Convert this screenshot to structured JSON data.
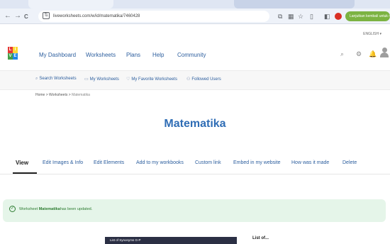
{
  "browser": {
    "back_icon": "←",
    "forward_icon": "→",
    "reload_icon": "C",
    "site_info_icon": "⇅",
    "url": "liveworksheets.com/w/id/matematika/7460428",
    "icons": [
      "translate-icon",
      "extension-icon",
      "star-icon",
      "puzzle-icon",
      "sidebar-icon",
      "profile-icon"
    ],
    "resume_label": "Lanjutkan kembali untuk mengupdate",
    "menu_icon": "⋮"
  },
  "site": {
    "language": "ENGLISH",
    "logo_letters": [
      "L",
      "I",
      "V",
      "E"
    ],
    "logo_colors": [
      "#e53935",
      "#fdd835",
      "#43a047",
      "#1e88e5"
    ],
    "nav": [
      "My Dashboard",
      "Worksheets",
      "Plans",
      "Help",
      "Community"
    ],
    "sub_nav": [
      {
        "icon": "search-icon",
        "glyph": "🔍",
        "label": "Search Worksheets"
      },
      {
        "icon": "book-icon",
        "glyph": "📖",
        "label": "My Worksheets"
      },
      {
        "icon": "heart-icon",
        "glyph": "♡",
        "label": "My Favorite Worksheets"
      },
      {
        "icon": "users-icon",
        "glyph": "👥",
        "label": "Followed Users"
      }
    ],
    "breadcrumb": [
      "Home",
      ">",
      "Worksheets",
      ">",
      "Matematika"
    ]
  },
  "main": {
    "title": "Matematika",
    "tabs": [
      "View",
      "Edit Images & Info",
      "Edit Elements",
      "Add to my workbooks",
      "Custom link",
      "Embed in my website",
      "How was it made",
      "Delete"
    ],
    "alert": {
      "prefix": "Worksheet ",
      "name": "Matematika",
      "suffix": "has been updated."
    },
    "preview_title": "List of Synonyms G-P",
    "side_title": "List of..."
  }
}
